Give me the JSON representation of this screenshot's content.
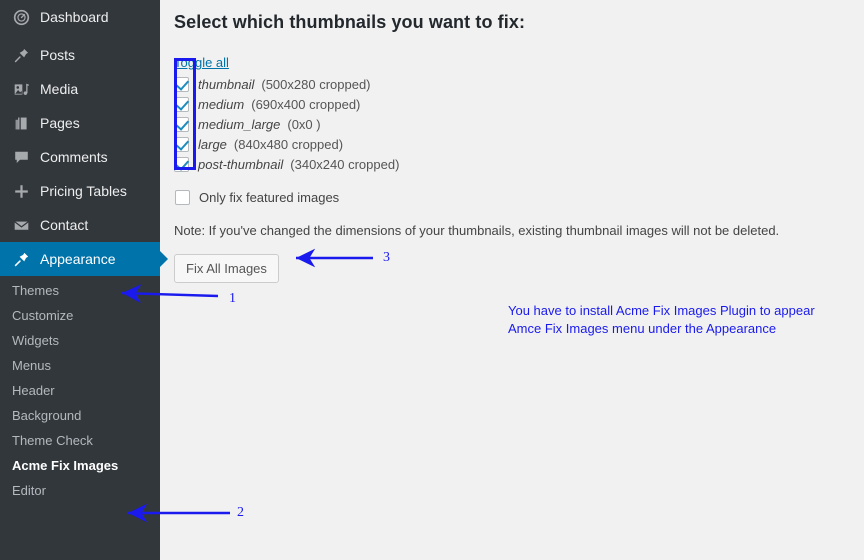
{
  "sidebar": {
    "items": [
      {
        "label": "Dashboard",
        "icon": "dashboard-icon",
        "active": false
      },
      {
        "label": "Posts",
        "icon": "pin-icon",
        "active": false
      },
      {
        "label": "Media",
        "icon": "media-icon",
        "active": false
      },
      {
        "label": "Pages",
        "icon": "pages-icon",
        "active": false
      },
      {
        "label": "Comments",
        "icon": "comments-icon",
        "active": false
      },
      {
        "label": "Pricing Tables",
        "icon": "plus-icon",
        "active": false
      },
      {
        "label": "Contact",
        "icon": "envelope-icon",
        "active": false
      },
      {
        "label": "Appearance",
        "icon": "paintbrush-icon",
        "active": true
      }
    ],
    "submenu": [
      {
        "label": "Themes",
        "current": false
      },
      {
        "label": "Customize",
        "current": false
      },
      {
        "label": "Widgets",
        "current": false
      },
      {
        "label": "Menus",
        "current": false
      },
      {
        "label": "Header",
        "current": false
      },
      {
        "label": "Background",
        "current": false
      },
      {
        "label": "Theme Check",
        "current": false
      },
      {
        "label": "Acme Fix Images",
        "current": true
      },
      {
        "label": "Editor",
        "current": false
      }
    ],
    "active_color": "#0073aa",
    "background_color": "#32373c"
  },
  "main": {
    "page_title": "Select which thumbnails you want to fix:",
    "toggle_all_label": "Toggle all",
    "thumbnail_sizes": [
      {
        "name": "thumbnail",
        "dimensions": "(500x280 cropped)",
        "checked": true
      },
      {
        "name": "medium",
        "dimensions": "(690x400 cropped)",
        "checked": true
      },
      {
        "name": "medium_large",
        "dimensions": "(0x0 )",
        "checked": true
      },
      {
        "name": "large",
        "dimensions": "(840x480 cropped)",
        "checked": true
      },
      {
        "name": "post-thumbnail",
        "dimensions": "(340x240 cropped)",
        "checked": true
      }
    ],
    "featured_only": {
      "label": "Only fix featured images",
      "checked": false
    },
    "note": "Note: If you've changed the dimensions of your thumbnails, existing thumbnail images will not be deleted.",
    "fix_button_label": "Fix All Images"
  },
  "annotations": {
    "color": "#1a1aee",
    "markers": [
      {
        "id": "1",
        "label": "1"
      },
      {
        "id": "2",
        "label": "2"
      },
      {
        "id": "3",
        "label": "3"
      }
    ],
    "note_line1": "You have to install Acme Fix Images Plugin to appear",
    "note_line2": "Amce Fix Images menu under the Appearance"
  }
}
